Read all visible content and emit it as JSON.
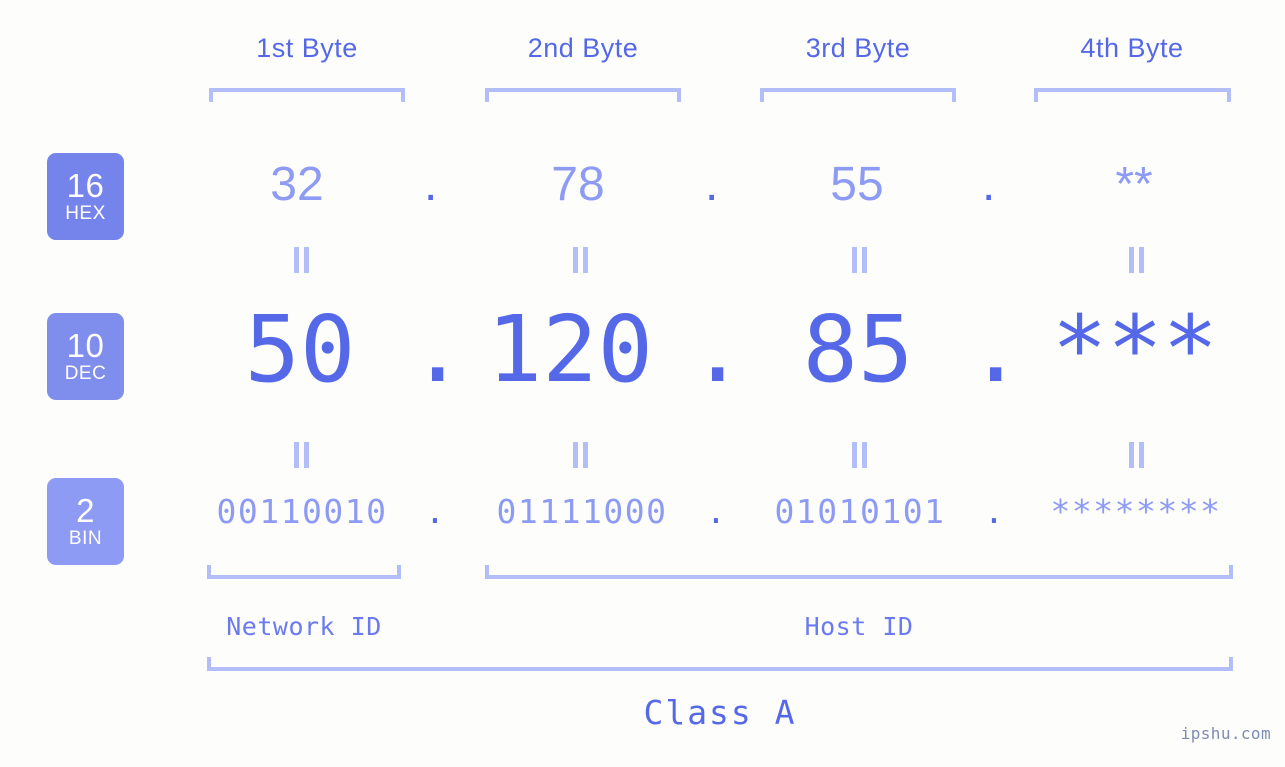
{
  "meta": {
    "background_color": "#fdfefb",
    "accent_dark": "#5568e8",
    "accent_mid": "#8e9bf5",
    "accent_light": "#b3bdf7",
    "watermark": "ipshu.com"
  },
  "byte_headers": [
    {
      "label": "1st Byte"
    },
    {
      "label": "2nd Byte"
    },
    {
      "label": "3rd Byte"
    },
    {
      "label": "4th Byte"
    }
  ],
  "bases": [
    {
      "number": "16",
      "name": "HEX",
      "color": "#7584ea"
    },
    {
      "number": "10",
      "name": "DEC",
      "color": "#7f8dec"
    },
    {
      "number": "2",
      "name": "BIN",
      "color": "#8e9bf5"
    }
  ],
  "rows": {
    "hex": {
      "base_number": "16",
      "base_name": "HEX",
      "values": [
        "32",
        "78",
        "55",
        "**"
      ],
      "separators": [
        ".",
        ".",
        "."
      ]
    },
    "dec": {
      "base_number": "10",
      "base_name": "DEC",
      "values": [
        "50",
        "120",
        "85",
        "***"
      ],
      "separators": [
        ".",
        ".",
        "."
      ]
    },
    "bin": {
      "base_number": "2",
      "base_name": "BIN",
      "values": [
        "00110010",
        "01111000",
        "01010101",
        "********"
      ],
      "separators": [
        ".",
        ".",
        "."
      ]
    }
  },
  "equals_marks": {
    "glyph": "=",
    "count_per_gap": 4,
    "gaps": [
      "hex-to-dec",
      "dec-to-bin"
    ]
  },
  "sections": [
    {
      "label": "Network ID"
    },
    {
      "label": "Host ID"
    }
  ],
  "class": {
    "label": "Class A"
  }
}
